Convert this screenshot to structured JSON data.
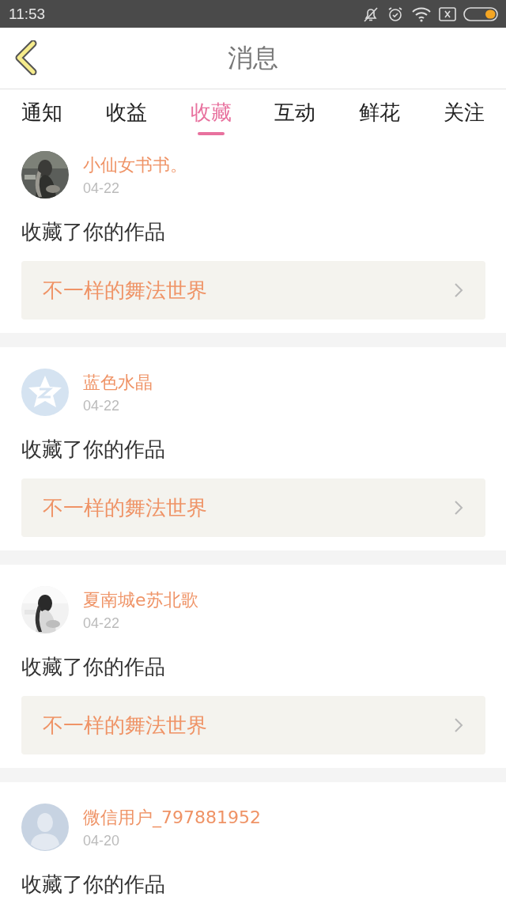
{
  "status_bar": {
    "time": "11:53"
  },
  "header": {
    "title": "消息"
  },
  "tabs": [
    {
      "label": "通知",
      "selected": false
    },
    {
      "label": "收益",
      "selected": false
    },
    {
      "label": "收藏",
      "selected": true
    },
    {
      "label": "互动",
      "selected": false
    },
    {
      "label": "鲜花",
      "selected": false
    },
    {
      "label": "关注",
      "selected": false
    }
  ],
  "messages": [
    {
      "user": "小仙女书书。",
      "date": "04-22",
      "action": "收藏了你的作品",
      "work": "不一样的舞法世界"
    },
    {
      "user": "蓝色水晶",
      "date": "04-22",
      "avatar": {
        "kind": "star"
      },
      "action": "收藏了你的作品",
      "work": "不一样的舞法世界"
    },
    {
      "user": "夏南城e苏北歌",
      "date": "04-22",
      "action": "收藏了你的作品",
      "work": "不一样的舞法世界"
    },
    {
      "user": "微信用户_797881952",
      "date": "04-20",
      "avatar": {
        "kind": "silhouette"
      },
      "action": "收藏了你的作品"
    }
  ]
}
